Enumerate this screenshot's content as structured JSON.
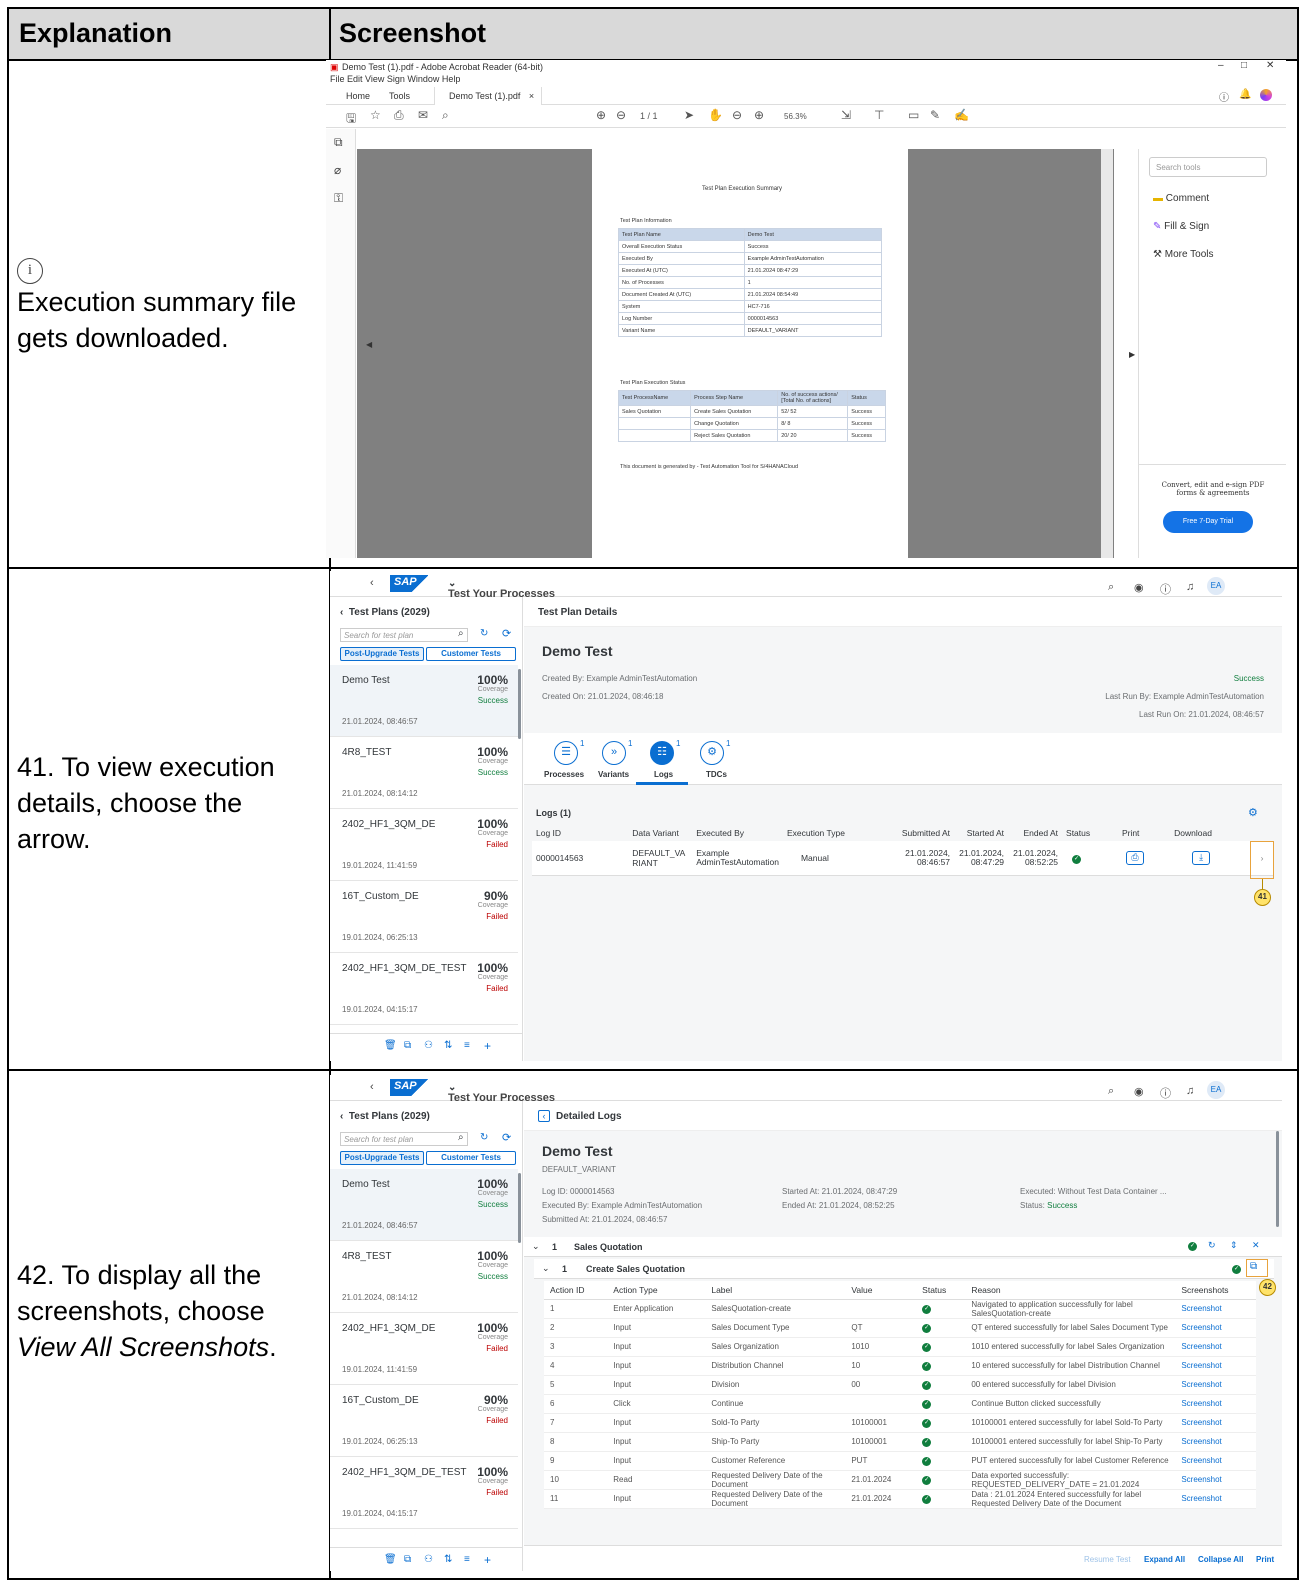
{
  "header": {
    "col1": "Explanation",
    "col2": "Screenshot"
  },
  "rows": [
    {
      "info_icon": "i",
      "text": "Execution summary file gets downloaded."
    },
    {
      "text": "41. To view execution details, choose the arrow."
    },
    {
      "text_prefix": "42. To display all the screenshots, choose ",
      "text_italic": "View All Screenshots",
      "text_suffix": "."
    }
  ],
  "acrobat": {
    "title": "Demo Test (1).pdf - Adobe Acrobat Reader (64-bit)",
    "menu": "File  Edit  View  Sign  Window  Help",
    "tabs": [
      "Home",
      "Tools",
      "Demo Test (1).pdf"
    ],
    "page_counter": "1 / 1",
    "zoom": "56.3%",
    "search_placeholder": "Search tools",
    "tools": [
      "Comment",
      "Fill & Sign",
      "More Tools"
    ],
    "promo": "Convert, edit and e-sign PDF forms & agreements",
    "trial_button": "Free 7-Day Trial",
    "pdf": {
      "title": "Test Plan Execution Summary",
      "info_heading": "Test Plan Information",
      "info_rows": [
        [
          "Test Plan Name",
          "Demo Test"
        ],
        [
          "Overall Execution Status",
          "Success"
        ],
        [
          "Executed By",
          "Example AdminTestAutomation"
        ],
        [
          "Executed At (UTC)",
          "21.01.2024 08:47:29"
        ],
        [
          "No. of Processes",
          "1"
        ],
        [
          "Document Created At (UTC)",
          "21.01.2024 08:54:49"
        ],
        [
          "System",
          "HC7-716"
        ],
        [
          "Log Number",
          "0000014563"
        ],
        [
          "Variant Name",
          "DEFAULT_VARIANT"
        ]
      ],
      "status_heading": "Test Plan Execution Status",
      "status_header": [
        "Test ProcessName",
        "Process Step Name",
        "No. of success actions/ [Total No. of actions]",
        "Status"
      ],
      "status_rows": [
        [
          "Sales Quotation",
          "Create Sales Quotation",
          "52/ 52",
          "Success"
        ],
        [
          "",
          "Change Quotation",
          "8/ 8",
          "Success"
        ],
        [
          "",
          "Reject Sales Quotation",
          "20/ 20",
          "Success"
        ]
      ],
      "footer": "This document is generated by - Test Automation Tool for S/4HANACloud"
    }
  },
  "sap": {
    "logo": "SAP",
    "app_title": "Test Your Processes",
    "user_initials": "EA",
    "sidebar_title": "Test Plans (2029)",
    "search_placeholder": "Search for test plan",
    "seg_buttons": [
      "Post-Upgrade Tests",
      "Customer Tests"
    ],
    "coverage_label": "Coverage",
    "plans": [
      {
        "name": "Demo Test",
        "pct": "100%",
        "status": "Success",
        "date": "21.01.2024, 08:46:57"
      },
      {
        "name": "4R8_TEST",
        "pct": "100%",
        "status": "Success",
        "date": "21.01.2024, 08:14:12"
      },
      {
        "name": "2402_HF1_3QM_DE",
        "pct": "100%",
        "status": "Failed",
        "date": "19.01.2024, 11:41:59"
      },
      {
        "name": "16T_Custom_DE",
        "pct": "90%",
        "status": "Failed",
        "date": "19.01.2024, 06:25:13"
      },
      {
        "name": "2402_HF1_3QM_DE_TEST",
        "pct": "100%",
        "status": "Failed",
        "date": "19.01.2024, 04:15:17"
      }
    ]
  },
  "details": {
    "page_title": "Test Plan Details",
    "name": "Demo Test",
    "created_by": "Created By: Example AdminTestAutomation",
    "created_on": "Created On: 21.01.2024, 08:46:18",
    "status": "Success",
    "last_run_by": "Last Run By: Example AdminTestAutomation",
    "last_run_on": "Last Run On: 21.01.2024, 08:46:57",
    "tabs": [
      {
        "label": "Processes",
        "count": "1"
      },
      {
        "label": "Variants",
        "count": "1"
      },
      {
        "label": "Logs",
        "count": "1"
      },
      {
        "label": "TDCs",
        "count": "1"
      }
    ],
    "logs_title": "Logs (1)",
    "log_columns": [
      "Log ID",
      "Data Variant",
      "Executed By",
      "Execution Type",
      "Submitted At",
      "Started At",
      "Ended At",
      "Status",
      "Print",
      "Download"
    ],
    "log_row": {
      "id": "0000014563",
      "variant": "DEFAULT_VARIANT",
      "by": "Example AdminTestAutomation",
      "type": "Manual",
      "submitted": "21.01.2024, 08:46:57",
      "started": "21.01.2024, 08:47:29",
      "ended": "21.01.2024, 08:52:25"
    },
    "badge": "41"
  },
  "logs": {
    "page_title": "Detailed Logs",
    "name": "Demo Test",
    "variant": "DEFAULT_VARIANT",
    "log_id": "Log ID: 0000014563",
    "executed_by": "Executed By: Example AdminTestAutomation",
    "submitted_at": "Submitted At: 21.01.2024, 08:46:57",
    "started_at": "Started At: 21.01.2024, 08:47:29",
    "ended_at": "Ended At: 21.01.2024, 08:52:25",
    "executed": "Executed: Without Test Data Container ...",
    "status_label": "Status: ",
    "status_value": "Success",
    "process_no": "1",
    "process": "Sales Quotation",
    "step_no": "1",
    "step": "Create Sales Quotation",
    "badge": "42",
    "columns": [
      "Action ID",
      "Action Type",
      "Label",
      "Value",
      "Status",
      "Reason",
      "Screenshots"
    ],
    "rows": [
      [
        "1",
        "Enter Application",
        "SalesQuotation-create",
        "",
        "Navigated to application successfully for label SalesQuotation-create",
        "Screenshot"
      ],
      [
        "2",
        "Input",
        "Sales Document Type",
        "QT",
        "QT entered successfully for label Sales Document Type",
        "Screenshot"
      ],
      [
        "3",
        "Input",
        "Sales Organization",
        "1010",
        "1010 entered successfully for label Sales Organization",
        "Screenshot"
      ],
      [
        "4",
        "Input",
        "Distribution Channel",
        "10",
        "10 entered successfully for label Distribution Channel",
        "Screenshot"
      ],
      [
        "5",
        "Input",
        "Division",
        "00",
        "00 entered successfully for label Division",
        "Screenshot"
      ],
      [
        "6",
        "Click",
        "Continue",
        "",
        "Continue Button clicked successfully",
        "Screenshot"
      ],
      [
        "7",
        "Input",
        "Sold-To Party",
        "10100001",
        "10100001 entered successfully for label Sold-To Party",
        "Screenshot"
      ],
      [
        "8",
        "Input",
        "Ship-To Party",
        "10100001",
        "10100001 entered successfully for label Ship-To Party",
        "Screenshot"
      ],
      [
        "9",
        "Input",
        "Customer Reference",
        "PUT",
        "PUT entered successfully for label Customer Reference",
        "Screenshot"
      ],
      [
        "10",
        "Read",
        "Requested Delivery Date of the Document",
        "21.01.2024",
        "Data exported successfully: REQUESTED_DELIVERY_DATE = 21.01.2024",
        "Screenshot"
      ],
      [
        "11",
        "Input",
        "Requested Delivery Date of the Document",
        "21.01.2024",
        "Data : 21.01.2024 Entered successfully for label Requested Delivery Date of the Document",
        "Screenshot"
      ]
    ],
    "footer_buttons": [
      "Resume Test",
      "Expand All",
      "Collapse All",
      "Print"
    ]
  }
}
